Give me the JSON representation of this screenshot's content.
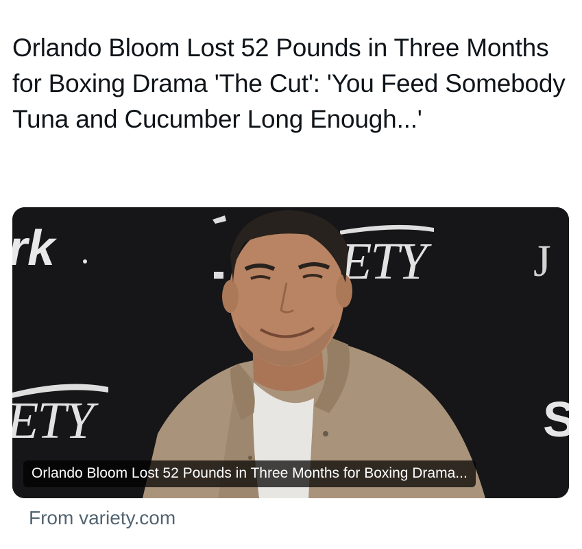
{
  "tweet": {
    "text": "Orlando Bloom Lost 52 Pounds in Three Months for Boxing Drama 'The Cut': 'You Feed Somebody Tuna and Cucumber Long Enough...'"
  },
  "card": {
    "image_alt": "Orlando Bloom smiling in front of a Variety backdrop",
    "backdrop_text": {
      "top_left": "rk",
      "top_center": "ETY",
      "top_right": "J",
      "bottom_left": "ETY",
      "bottom_right": "S"
    },
    "caption": "Orlando Bloom Lost 52 Pounds in Three Months for Boxing Drama...",
    "source": "From variety.com"
  },
  "colors": {
    "backdrop": "#17171a",
    "jacket": "#b09a80",
    "shirt": "#f2f0ec",
    "skin": "#c08a68",
    "hair": "#2a2420",
    "source_text": "#536471"
  }
}
